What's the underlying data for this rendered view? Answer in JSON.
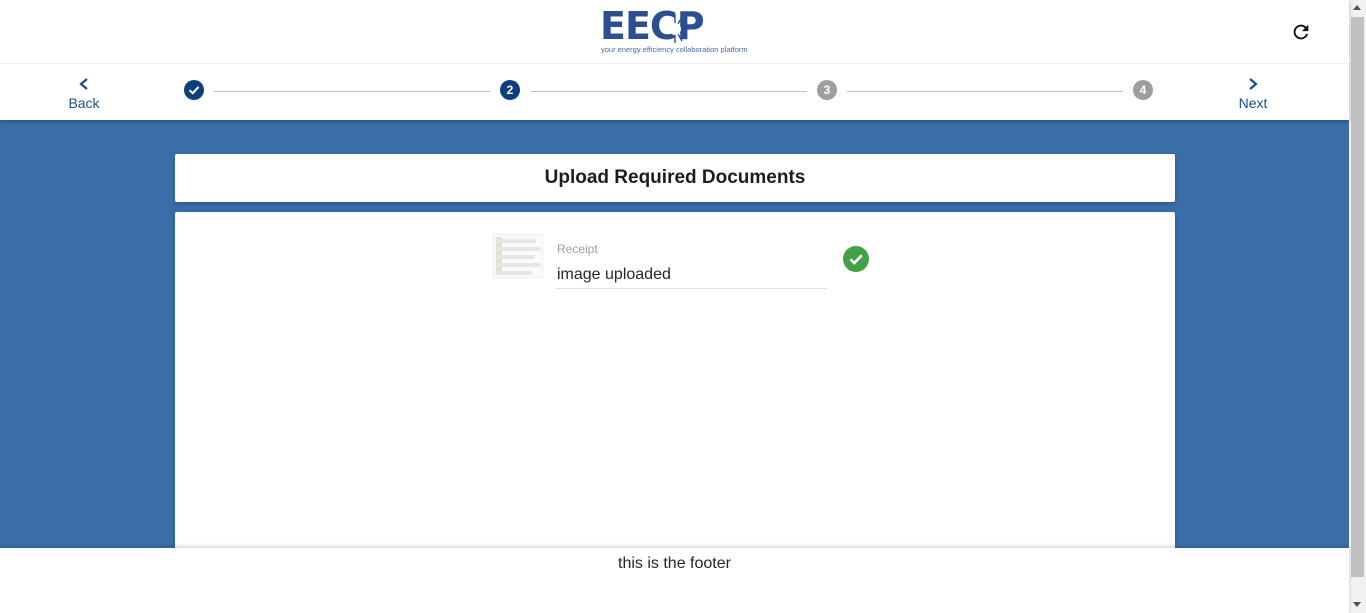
{
  "brand": {
    "logo_text": "EECP",
    "tagline": "your energy efficiency collaboration platform",
    "color": "#2c4f90"
  },
  "header": {
    "refresh_icon": "refresh-icon",
    "back_label": "Back",
    "next_label": "Next"
  },
  "stepper": {
    "steps": [
      {
        "label": "",
        "state": "done",
        "icon": "check-icon"
      },
      {
        "label": "2",
        "state": "active"
      },
      {
        "label": "3",
        "state": "todo"
      },
      {
        "label": "4",
        "state": "todo"
      }
    ],
    "active_color": "#0d3f7f",
    "inactive_color": "#9e9e9e"
  },
  "page": {
    "title": "Upload Required Documents",
    "background": "#3a6ea8"
  },
  "upload": {
    "field_label": "Receipt",
    "field_value": "image uploaded",
    "status_icon": "check-circle-icon",
    "status_color": "#43a047"
  },
  "footer": {
    "text": "this is the footer"
  }
}
